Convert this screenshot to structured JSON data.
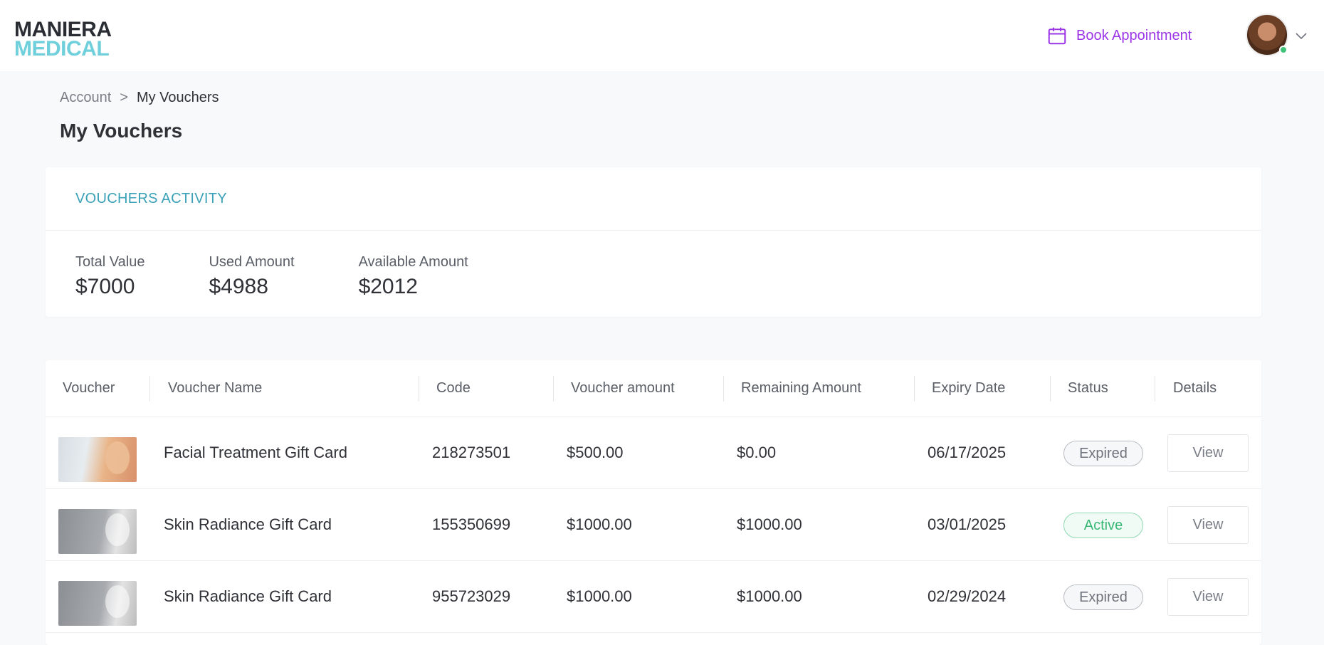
{
  "header": {
    "logo_line1": "MANIERA",
    "logo_line2": "MEDICAL",
    "book_label": "Book Appointment",
    "accent": "#9b35e6"
  },
  "breadcrumb": {
    "parent": "Account",
    "separator": ">",
    "current": "My Vouchers"
  },
  "page_title": "My Vouchers",
  "activity": {
    "title": "VOUCHERS ACTIVITY",
    "stats": [
      {
        "label": "Total Value",
        "value": "$7000"
      },
      {
        "label": "Used Amount",
        "value": "$4988"
      },
      {
        "label": "Available Amount",
        "value": "$2012"
      }
    ]
  },
  "table": {
    "columns": [
      "Voucher",
      "Voucher Name",
      "Code",
      "Voucher amount",
      "Remaining Amount",
      "Expiry Date",
      "Status",
      "Details"
    ],
    "rows": [
      {
        "name": "Facial Treatment Gift Card",
        "code": "218273501",
        "amount": "$500.00",
        "remaining": "$0.00",
        "expiry": "06/17/2025",
        "status": "Expired",
        "details": "View"
      },
      {
        "name": "Skin Radiance Gift Card",
        "code": "155350699",
        "amount": "$1000.00",
        "remaining": "$1000.00",
        "expiry": "03/01/2025",
        "status": "Active",
        "details": "View"
      },
      {
        "name": "Skin Radiance Gift Card",
        "code": "955723029",
        "amount": "$1000.00",
        "remaining": "$1000.00",
        "expiry": "02/29/2024",
        "status": "Expired",
        "details": "View"
      }
    ]
  },
  "colors": {
    "expired": "#6f737b",
    "active": "#37b874",
    "activity_title": "#3aa1b8"
  }
}
